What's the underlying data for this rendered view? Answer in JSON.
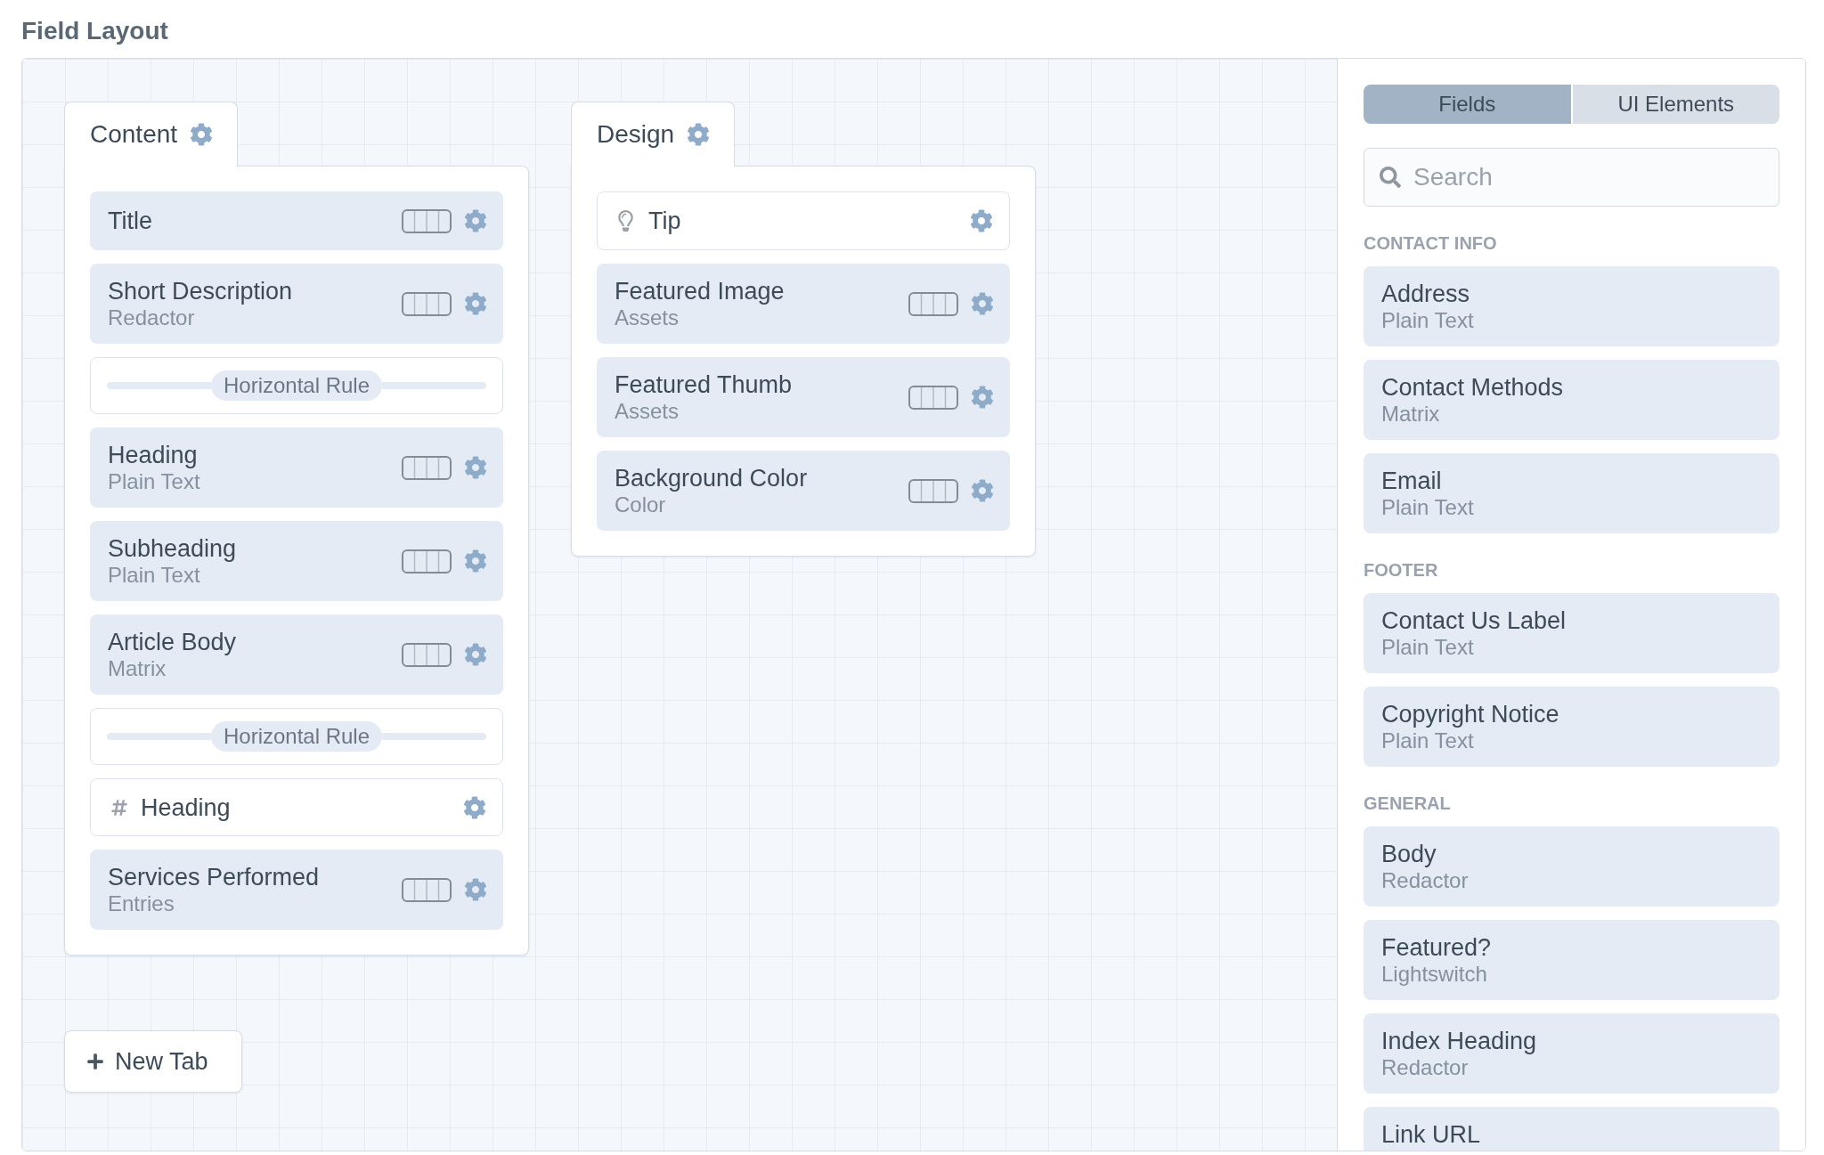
{
  "heading": "Field Layout",
  "layout_tabs": [
    {
      "label": "Content",
      "elements": [
        {
          "kind": "field",
          "name": "Title"
        },
        {
          "kind": "field",
          "name": "Short Description",
          "type": "Redactor"
        },
        {
          "kind": "rule",
          "label": "Horizontal Rule"
        },
        {
          "kind": "field",
          "name": "Heading",
          "type": "Plain Text"
        },
        {
          "kind": "field",
          "name": "Subheading",
          "type": "Plain Text"
        },
        {
          "kind": "field",
          "name": "Article Body",
          "type": "Matrix"
        },
        {
          "kind": "rule",
          "label": "Horizontal Rule"
        },
        {
          "kind": "heading",
          "label": "Heading"
        },
        {
          "kind": "field",
          "name": "Services Performed",
          "type": "Entries"
        }
      ]
    },
    {
      "label": "Design",
      "elements": [
        {
          "kind": "tip",
          "label": "Tip"
        },
        {
          "kind": "field",
          "name": "Featured Image",
          "type": "Assets"
        },
        {
          "kind": "field",
          "name": "Featured Thumb",
          "type": "Assets"
        },
        {
          "kind": "field",
          "name": "Background Color",
          "type": "Color"
        }
      ]
    }
  ],
  "new_tab_button": {
    "label": "New Tab"
  },
  "sidebar": {
    "tabs": [
      {
        "label": "Fields",
        "selected": true
      },
      {
        "label": "UI Elements",
        "selected": false
      }
    ],
    "search": {
      "placeholder": "Search"
    },
    "groups": [
      {
        "heading": "CONTACT INFO",
        "fields": [
          {
            "name": "Address",
            "type": "Plain Text"
          },
          {
            "name": "Contact Methods",
            "type": "Matrix"
          },
          {
            "name": "Email",
            "type": "Plain Text"
          }
        ]
      },
      {
        "heading": "FOOTER",
        "fields": [
          {
            "name": "Contact Us Label",
            "type": "Plain Text"
          },
          {
            "name": "Copyright Notice",
            "type": "Plain Text"
          }
        ]
      },
      {
        "heading": "GENERAL",
        "fields": [
          {
            "name": "Body",
            "type": "Redactor"
          },
          {
            "name": "Featured?",
            "type": "Lightswitch"
          },
          {
            "name": "Index Heading",
            "type": "Redactor"
          },
          {
            "name": "Link URL"
          }
        ]
      }
    ]
  }
}
